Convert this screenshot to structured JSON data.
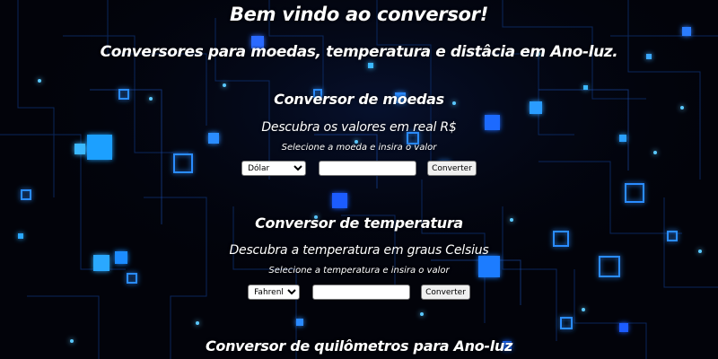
{
  "page": {
    "title": "Bem vindo ao conversor!",
    "subtitle": "Conversores para moedas, temperatura e distâcia em Ano-luz."
  },
  "currency": {
    "heading": "Conversor de moedas",
    "description": "Descubra os valores em real R$",
    "instruction": "Selecione a moeda e insira o valor",
    "selected_option": "Dólar",
    "input_value": "",
    "button_label": "Converter"
  },
  "temperature": {
    "heading": "Conversor de temperatura",
    "description": "Descubra a temperatura em graus Celsius",
    "instruction": "Selecione a temperatura e insira o valor",
    "selected_option": "Fahrenheit",
    "input_value": "",
    "button_label": "Converter"
  },
  "distance": {
    "heading": "Conversor de quilômetros para Ano-luz"
  },
  "colors": {
    "background": "#02030a",
    "text": "#ffffff",
    "accent_glow": "#1e7bff"
  }
}
